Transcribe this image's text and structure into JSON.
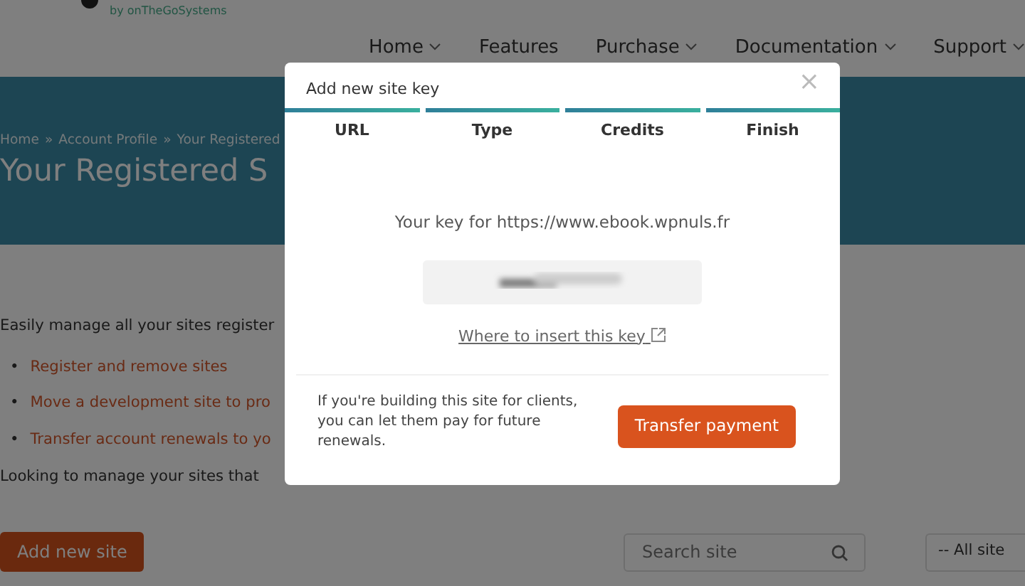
{
  "site": {
    "byline": "by onTheGoSystems",
    "nav": [
      {
        "label": "Home",
        "dropdown": true
      },
      {
        "label": "Features",
        "dropdown": false
      },
      {
        "label": "Purchase",
        "dropdown": true
      },
      {
        "label": "Documentation",
        "dropdown": true
      },
      {
        "label": "Support",
        "dropdown": true
      }
    ],
    "breadcrumb": [
      "Home",
      "Account Profile",
      "Your Registered"
    ],
    "breadcrumb_separator": "»",
    "title": "Your Registered S",
    "intro": "Easily manage all your sites register",
    "bullet": "•",
    "links": [
      "Register and remove sites",
      "Move a development site to pro",
      "Transfer account renewals to yo"
    ],
    "note": "Looking to manage your sites that",
    "add_button": "Add new site",
    "search": {
      "placeholder": "Search site"
    },
    "filter": "-- All site"
  },
  "modal": {
    "title": "Add new site key",
    "close": "×",
    "steps": [
      {
        "label": "URL",
        "done": true
      },
      {
        "label": "Type",
        "done": true
      },
      {
        "label": "Credits",
        "done": true
      },
      {
        "label": "Finish",
        "done": true
      }
    ],
    "key_prefix": "Your key for",
    "url": "https://www.ebook.wpnuls.fr",
    "key_blurred": true,
    "help_link": "Where to insert this key",
    "footer_text": "If you're building this site for clients, you can let them pay for future renewals.",
    "transfer_button": "Transfer payment"
  }
}
